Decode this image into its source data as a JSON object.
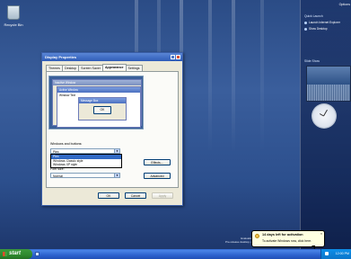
{
  "desktop": {
    "recycle_bin_label": "Recycle Bin"
  },
  "sidebar": {
    "options_label": "Options",
    "search_gadget_title": "Quick Launch",
    "search_items": [
      "Launch Internet Explorer",
      "Show Desktop"
    ],
    "slideshow_title": "Slide Show"
  },
  "dialog": {
    "title": "Display Properties",
    "tabs": [
      "Themes",
      "Desktop",
      "Screen Saver",
      "Appearance",
      "Settings"
    ],
    "active_tab": "Appearance",
    "preview": {
      "inactive_window_title": "Inactive Window",
      "active_window_title": "Active Window",
      "window_text": "Window Text",
      "message_box_title": "Message Box",
      "ok_label": "OK"
    },
    "windows_buttons_label": "Windows and buttons:",
    "windows_buttons_value": "Plex",
    "dropdown_options": [
      "Plex",
      "Windows Classic style",
      "Windows XP style"
    ],
    "effects_label": "Effects...",
    "font_size_label": "Font size:",
    "font_size_value": "Normal",
    "advanced_label": "Advanced",
    "ok_label": "OK",
    "cancel_label": "Cancel",
    "apply_label": "Apply"
  },
  "balloon": {
    "title": "14 days left for activation",
    "body": "To activate Windows now, click here."
  },
  "watermark": {
    "line1": "Evaluation copy.",
    "line2": "Pre-release desktop, not final"
  },
  "taskbar": {
    "start_label": "start",
    "clock": "12:00 PM"
  },
  "colors": {
    "desktop_blue": "#2c4f8d",
    "xp_title_blue": "#2f5cb8",
    "start_green": "#2f8a2f",
    "balloon_yellow": "#ffffe1"
  }
}
